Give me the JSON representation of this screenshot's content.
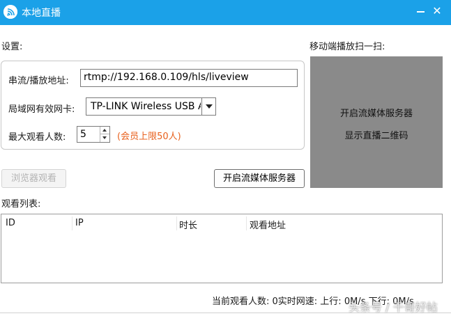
{
  "window": {
    "title": "本地直播",
    "minimize_glyph": "",
    "close_glyph": "✕"
  },
  "settings": {
    "label": "设置:",
    "stream_url_label": "串流/播放地址:",
    "stream_url_value": "rtmp://192.168.0.109/hls/liveview",
    "nic_label": "局域网有效网卡:",
    "nic_value": "TP-LINK Wireless USB A",
    "max_viewers_label": "最大观看人数:",
    "max_viewers_value": "5",
    "member_note": "(会员上限50人)"
  },
  "buttons": {
    "browser_watch": "浏览器观看",
    "start_server": "开启流媒体服务器"
  },
  "mobile": {
    "label": "移动端播放扫一扫:",
    "line1": "开启流媒体服务器",
    "line2": "显示直播二维码"
  },
  "watch_list": {
    "label": "观看列表:",
    "columns": [
      "ID",
      "IP",
      "时长",
      "观看地址"
    ]
  },
  "status": {
    "viewers": "当前观看人数: 0",
    "speed": "实时网速: 上行: 0M/s 下行: 0M/s"
  },
  "watermark": "头条号 / 干哥好帖",
  "colors": {
    "titlebar": "#1ba1e8",
    "note": "#e8601c",
    "qr_panel": "#8a8a8a"
  },
  "icons": {
    "app": "live-broadcast-icon",
    "minimize": "minimize-icon",
    "close": "close-icon",
    "dropdown": "chevron-down-icon"
  }
}
